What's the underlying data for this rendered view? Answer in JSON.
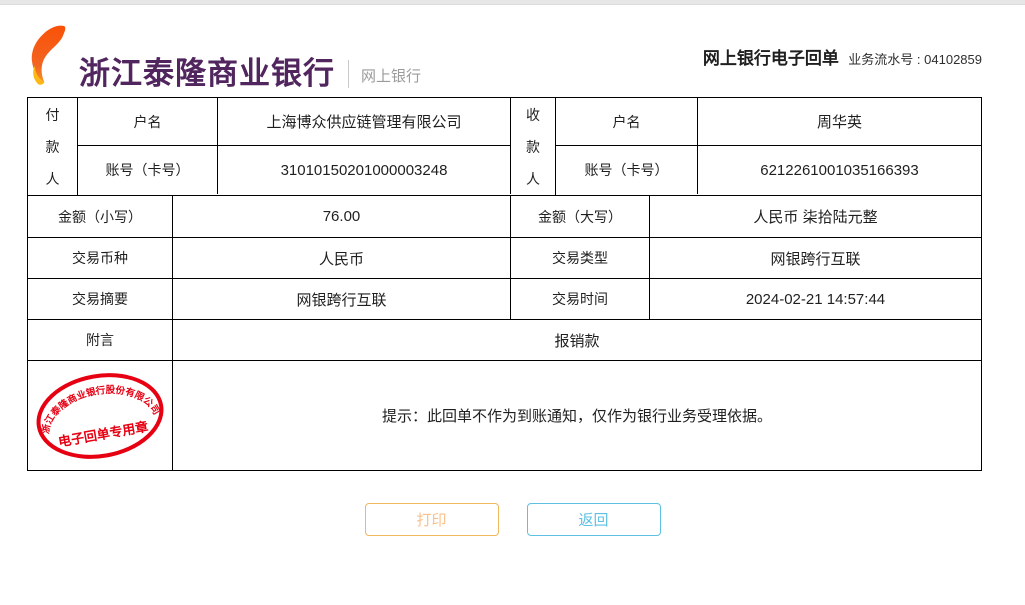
{
  "header": {
    "bank_name": "浙江泰隆商业银行",
    "logo_sub": "网上银行",
    "receipt_title": "网上银行电子回单",
    "serial_label": "业务流水号 :",
    "serial_value": "04102859"
  },
  "receipt": {
    "payer": {
      "side_label": "付款人",
      "name_label": "户名",
      "name_value": "上海博众供应链管理有限公司",
      "account_label": "账号（卡号）",
      "account_value": "31010150201000003248"
    },
    "payee": {
      "side_label": "收款人",
      "name_label": "户名",
      "name_value": "周华英",
      "account_label": "账号（卡号）",
      "account_value": "6212261001035166393"
    },
    "rows": [
      {
        "left_label": "金额（小写）",
        "left_value": "76.00",
        "right_label": "金额（大写）",
        "right_value": "人民币 柒拾陆元整"
      },
      {
        "left_label": "交易币种",
        "left_value": "人民币",
        "right_label": "交易类型",
        "right_value": "网银跨行互联"
      },
      {
        "left_label": "交易摘要",
        "left_value": "网银跨行互联",
        "right_label": "交易时间",
        "right_value": "2024-02-21 14:57:44"
      }
    ],
    "remark": {
      "label": "附言",
      "value": "报销款"
    },
    "stamp": {
      "arc_text": "浙江泰隆商业银行股份有限公司",
      "center_text": "电子回单专用章"
    },
    "notice": "提示：此回单不作为到账通知，仅作为银行业务受理依据。"
  },
  "buttons": {
    "print": "打印",
    "back": "返回"
  },
  "colors": {
    "brand_purple": "#51265e",
    "logo_orange": "#f26522",
    "logo_yellow": "#fdb813",
    "stamp_red": "#e60012",
    "print_accent": "#f0b85f",
    "back_accent": "#5fc0e4",
    "table_border": "#000000"
  }
}
